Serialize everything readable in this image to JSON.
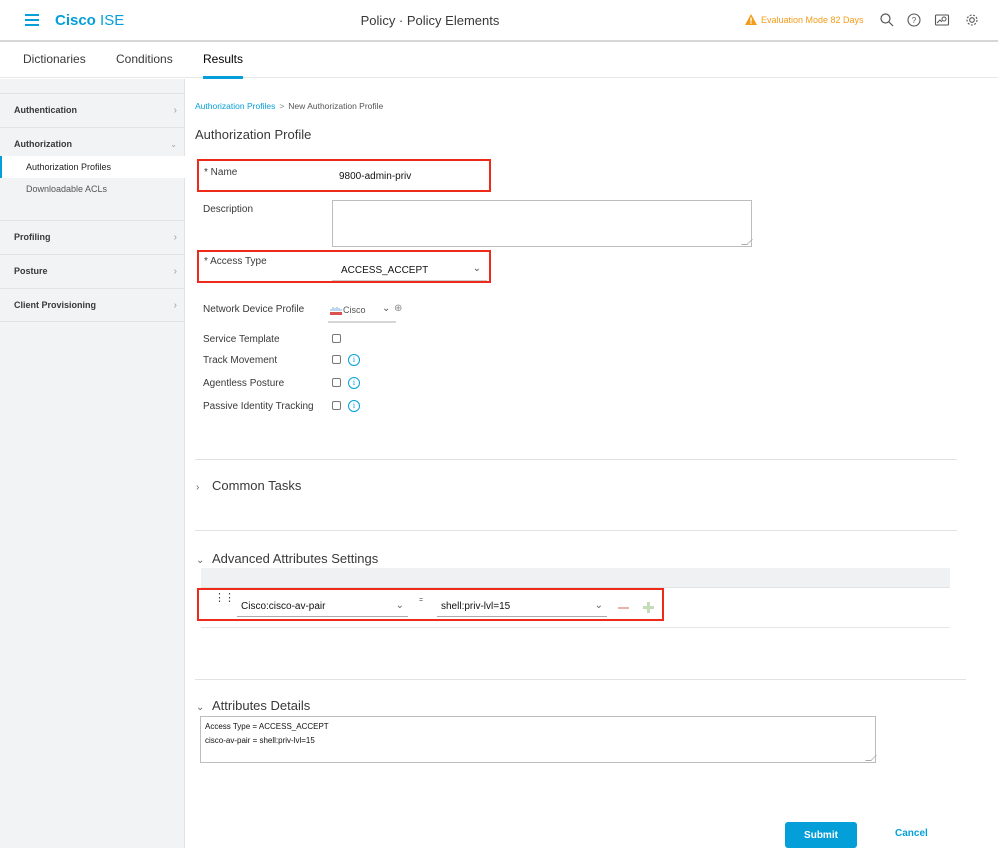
{
  "header": {
    "brand_bold": "Cisco",
    "brand_light": " ISE",
    "page_title": "Policy · Policy Elements",
    "evaluation_notice": "Evaluation Mode 82 Days",
    "icons": [
      "search-icon",
      "help-icon",
      "notifications-icon",
      "settings-icon"
    ],
    "accent_color": "#049fd9",
    "warning_color": "#f29c1a"
  },
  "tabs": [
    {
      "label": "Dictionaries",
      "active": false
    },
    {
      "label": "Conditions",
      "active": false
    },
    {
      "label": "Results",
      "active": true
    }
  ],
  "sidebar": {
    "sections": [
      {
        "label": "Authentication",
        "expanded": false
      },
      {
        "label": "Authorization",
        "expanded": true,
        "items": [
          {
            "label": "Authorization Profiles",
            "active": true
          },
          {
            "label": "Downloadable ACLs",
            "active": false
          }
        ]
      },
      {
        "label": "Profiling",
        "expanded": false
      },
      {
        "label": "Posture",
        "expanded": false
      },
      {
        "label": "Client Provisioning",
        "expanded": false
      }
    ]
  },
  "breadcrumb": {
    "parent": "Authorization Profiles",
    "separator": ">",
    "current": "New Authorization Profile"
  },
  "form": {
    "title": "Authorization Profile",
    "name_label": "* Name",
    "name_value": "9800-admin-priv",
    "description_label": "Description",
    "description_value": "",
    "access_type_label": "* Access Type",
    "access_type_value": "ACCESS_ACCEPT",
    "ndp_label": "Network Device Profile",
    "ndp_value": "Cisco",
    "checkboxes": [
      {
        "label": "Service Template",
        "checked": false,
        "info": false
      },
      {
        "label": "Track Movement",
        "checked": false,
        "info": true
      },
      {
        "label": "Agentless Posture",
        "checked": false,
        "info": true
      },
      {
        "label": "Passive Identity Tracking",
        "checked": false,
        "info": true
      }
    ]
  },
  "sections": {
    "common_tasks": "Common Tasks",
    "advanced": "Advanced Attributes Settings",
    "details": "Attributes Details"
  },
  "advanced_row": {
    "attribute": "Cisco:cisco-av-pair",
    "operator": "=",
    "value": "shell:priv-lvl=15"
  },
  "attribute_details": [
    "Access Type = ACCESS_ACCEPT",
    "cisco-av-pair = shell:priv-lvl=15"
  ],
  "buttons": {
    "submit": "Submit",
    "cancel": "Cancel"
  }
}
